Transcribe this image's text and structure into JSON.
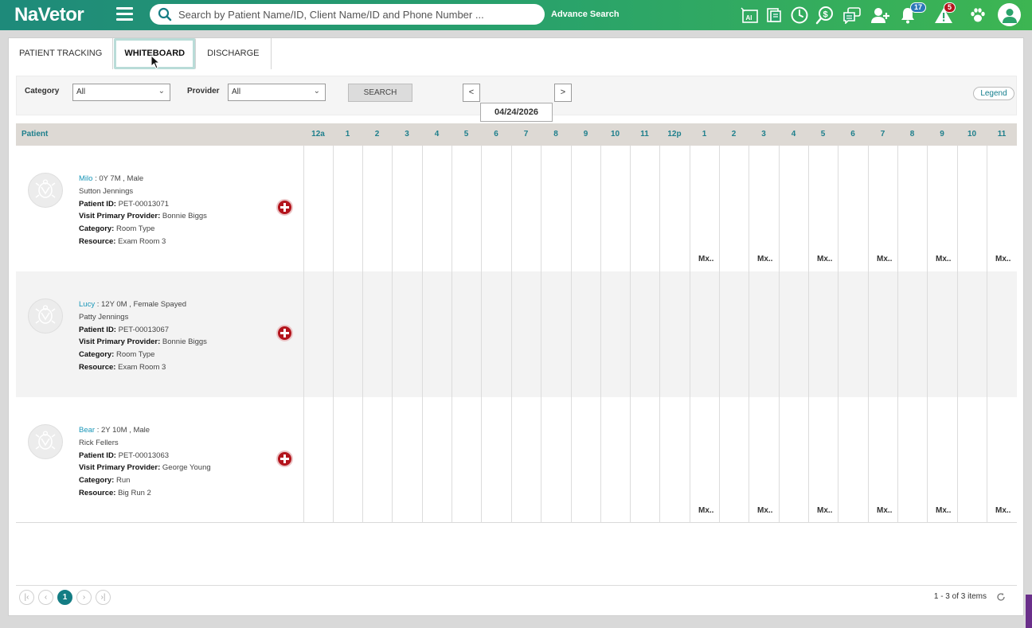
{
  "header": {
    "logo": "NaVetor",
    "search_placeholder": "Search by Patient Name/ID, Client Name/ID and Phone Number ...",
    "advance_search": "Advance Search",
    "notification_count": "17",
    "alert_count": "5",
    "icons": [
      "ai-icon",
      "document-icon",
      "clock-icon",
      "money-search-icon",
      "chat-icon",
      "add-user-icon",
      "bell-icon",
      "warning-icon",
      "paw-icon",
      "user-avatar-icon"
    ]
  },
  "tabs": [
    {
      "label": "PATIENT TRACKING"
    },
    {
      "label": "WHITEBOARD"
    },
    {
      "label": "DISCHARGE"
    }
  ],
  "filters": {
    "category_label": "Category",
    "category_value": "All",
    "provider_label": "Provider",
    "provider_value": "All",
    "search_label": "SEARCH",
    "prev_label": "<",
    "next_label": ">",
    "date": "04/24/2026",
    "legend_label": "Legend"
  },
  "grid": {
    "patient_header": "Patient",
    "hours": [
      "12a",
      "1",
      "2",
      "3",
      "4",
      "5",
      "6",
      "7",
      "8",
      "9",
      "10",
      "11",
      "12p",
      "1",
      "2",
      "3",
      "4",
      "5",
      "6",
      "7",
      "8",
      "9",
      "10",
      "11"
    ],
    "patients": [
      {
        "name": "Milo",
        "details": ": 0Y 7M , Male",
        "client": "Sutton Jennings",
        "patient_id_label": "Patient ID:",
        "patient_id": "PET-00013071",
        "provider_label": "Visit Primary Provider:",
        "provider": "Bonnie Biggs",
        "category_label": "Category:",
        "category": "Room Type",
        "resource_label": "Resource:",
        "resource": "Exam Room 3",
        "marker": "Mx.."
      },
      {
        "name": "Lucy",
        "details": ": 12Y 0M , Female Spayed",
        "client": "Patty Jennings",
        "patient_id_label": "Patient ID:",
        "patient_id": "PET-00013067",
        "provider_label": "Visit Primary Provider:",
        "provider": "Bonnie Biggs",
        "category_label": "Category:",
        "category": "Room Type",
        "resource_label": "Resource:",
        "resource": "Exam Room 3",
        "marker": ""
      },
      {
        "name": "Bear",
        "details": ": 2Y 10M , Male",
        "client": "Rick Fellers",
        "patient_id_label": "Patient ID:",
        "patient_id": "PET-00013063",
        "provider_label": "Visit Primary Provider:",
        "provider": "George Young",
        "category_label": "Category:",
        "category": "Run",
        "resource_label": "Resource:",
        "resource": "Big Run 2",
        "marker": "Mx.."
      }
    ]
  },
  "pager": {
    "first": "|<",
    "prev": "<",
    "current": "1",
    "next": ">",
    "last": ">|",
    "items_text": "1 - 3 of 3 items"
  },
  "colors": {
    "accent": "#147d84",
    "link": "#1996b8",
    "add_button": "#b3141c"
  }
}
